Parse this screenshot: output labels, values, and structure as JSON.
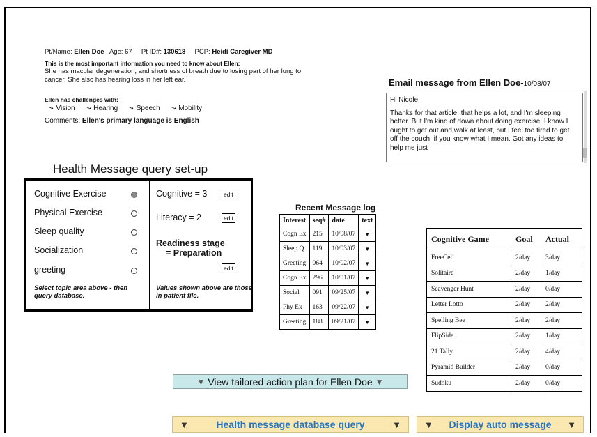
{
  "patient": {
    "name_label": "Pt/Name:",
    "name": "Ellen Doe",
    "age_label": "Age:",
    "age": "67",
    "id_label": "Pt ID#:",
    "id": "130618",
    "pcp_label": "PCP:",
    "pcp": "Heidi Caregiver MD",
    "important_note": "This is the most important information you need to know about Ellen:",
    "description": "She has macular degeneration, and shortness of breath due to losing part of her lung to cancer. She also has hearing loss in her left ear.",
    "challenges_title": "Ellen has challenges with:",
    "challenges": [
      "Vision",
      "Hearing",
      "Speech",
      "Mobility"
    ],
    "comments_label": "Comments:",
    "comments": "Ellen's primary language is English"
  },
  "email": {
    "title": "Email message from Ellen Doe-",
    "date": "10/08/07",
    "greeting": "Hi Nicole,",
    "body": "Thanks for that article, that helps a lot, and I'm sleeping better. But I'm kind of down about doing exercise.  I know I ought to get out and walk at least, but I feel too tired to get off the couch, if you know what I mean. Got any ideas to help me just"
  },
  "query": {
    "title": "Health Message query set-up",
    "topics": [
      {
        "label": "Cognitive Exercise",
        "selected": true
      },
      {
        "label": "Physical Exercise",
        "selected": false
      },
      {
        "label": "Sleep quality",
        "selected": false
      },
      {
        "label": "Socialization",
        "selected": false
      },
      {
        "label": "greeting",
        "selected": false
      }
    ],
    "topic_hint": "Select topic area above - then query database.",
    "cognitive": "Cognitive = 3",
    "literacy": "Literacy = 2",
    "readiness_line1": "Readiness stage",
    "readiness_line2": "= Preparation",
    "edit_label": "edit",
    "values_hint": "Values shown above are those in patient file."
  },
  "log": {
    "title": "Recent Message log",
    "headers": [
      "Interest",
      "seq#",
      "date",
      "text"
    ],
    "rows": [
      [
        "Cogn Ex",
        "215",
        "10/08/07"
      ],
      [
        "Sleep Q",
        "119",
        "10/03/07"
      ],
      [
        "Greeting",
        "064",
        "10/02/07"
      ],
      [
        "Cogn Ex",
        "296",
        "10/01/07"
      ],
      [
        "Social",
        "091",
        "09/25/07"
      ],
      [
        "Phy Ex",
        "163",
        "09/22/07"
      ],
      [
        "Greeting",
        "188",
        "09/21/07"
      ]
    ]
  },
  "games": {
    "headers": [
      "Cognitive Game",
      "Goal",
      "Actual"
    ],
    "rows": [
      [
        "FreeCell",
        "2/day",
        "3/day"
      ],
      [
        "Solitaire",
        "2/day",
        "1/day"
      ],
      [
        "Scavenger Hunt",
        "2/day",
        "0/day"
      ],
      [
        "Letter Lotto",
        "2/day",
        "2/day"
      ],
      [
        "Spelling Bee",
        "2/day",
        "2/day"
      ],
      [
        "FlipSide",
        "2/day",
        "1/day"
      ],
      [
        "21 Tally",
        "2/day",
        "4/day"
      ],
      [
        "Pyramid Builder",
        "2/day",
        "0/day"
      ],
      [
        "Sudoku",
        "2/day",
        "0/day"
      ]
    ]
  },
  "buttons": {
    "action_plan": "View tailored action plan for Ellen Doe",
    "db_query": "Health message database query",
    "auto_message": "Display auto message"
  },
  "colors": {
    "action_plan_bg": "#c8e8ea",
    "bottom_button_bg": "#fae8b0",
    "bottom_button_text": "#2474c4"
  }
}
